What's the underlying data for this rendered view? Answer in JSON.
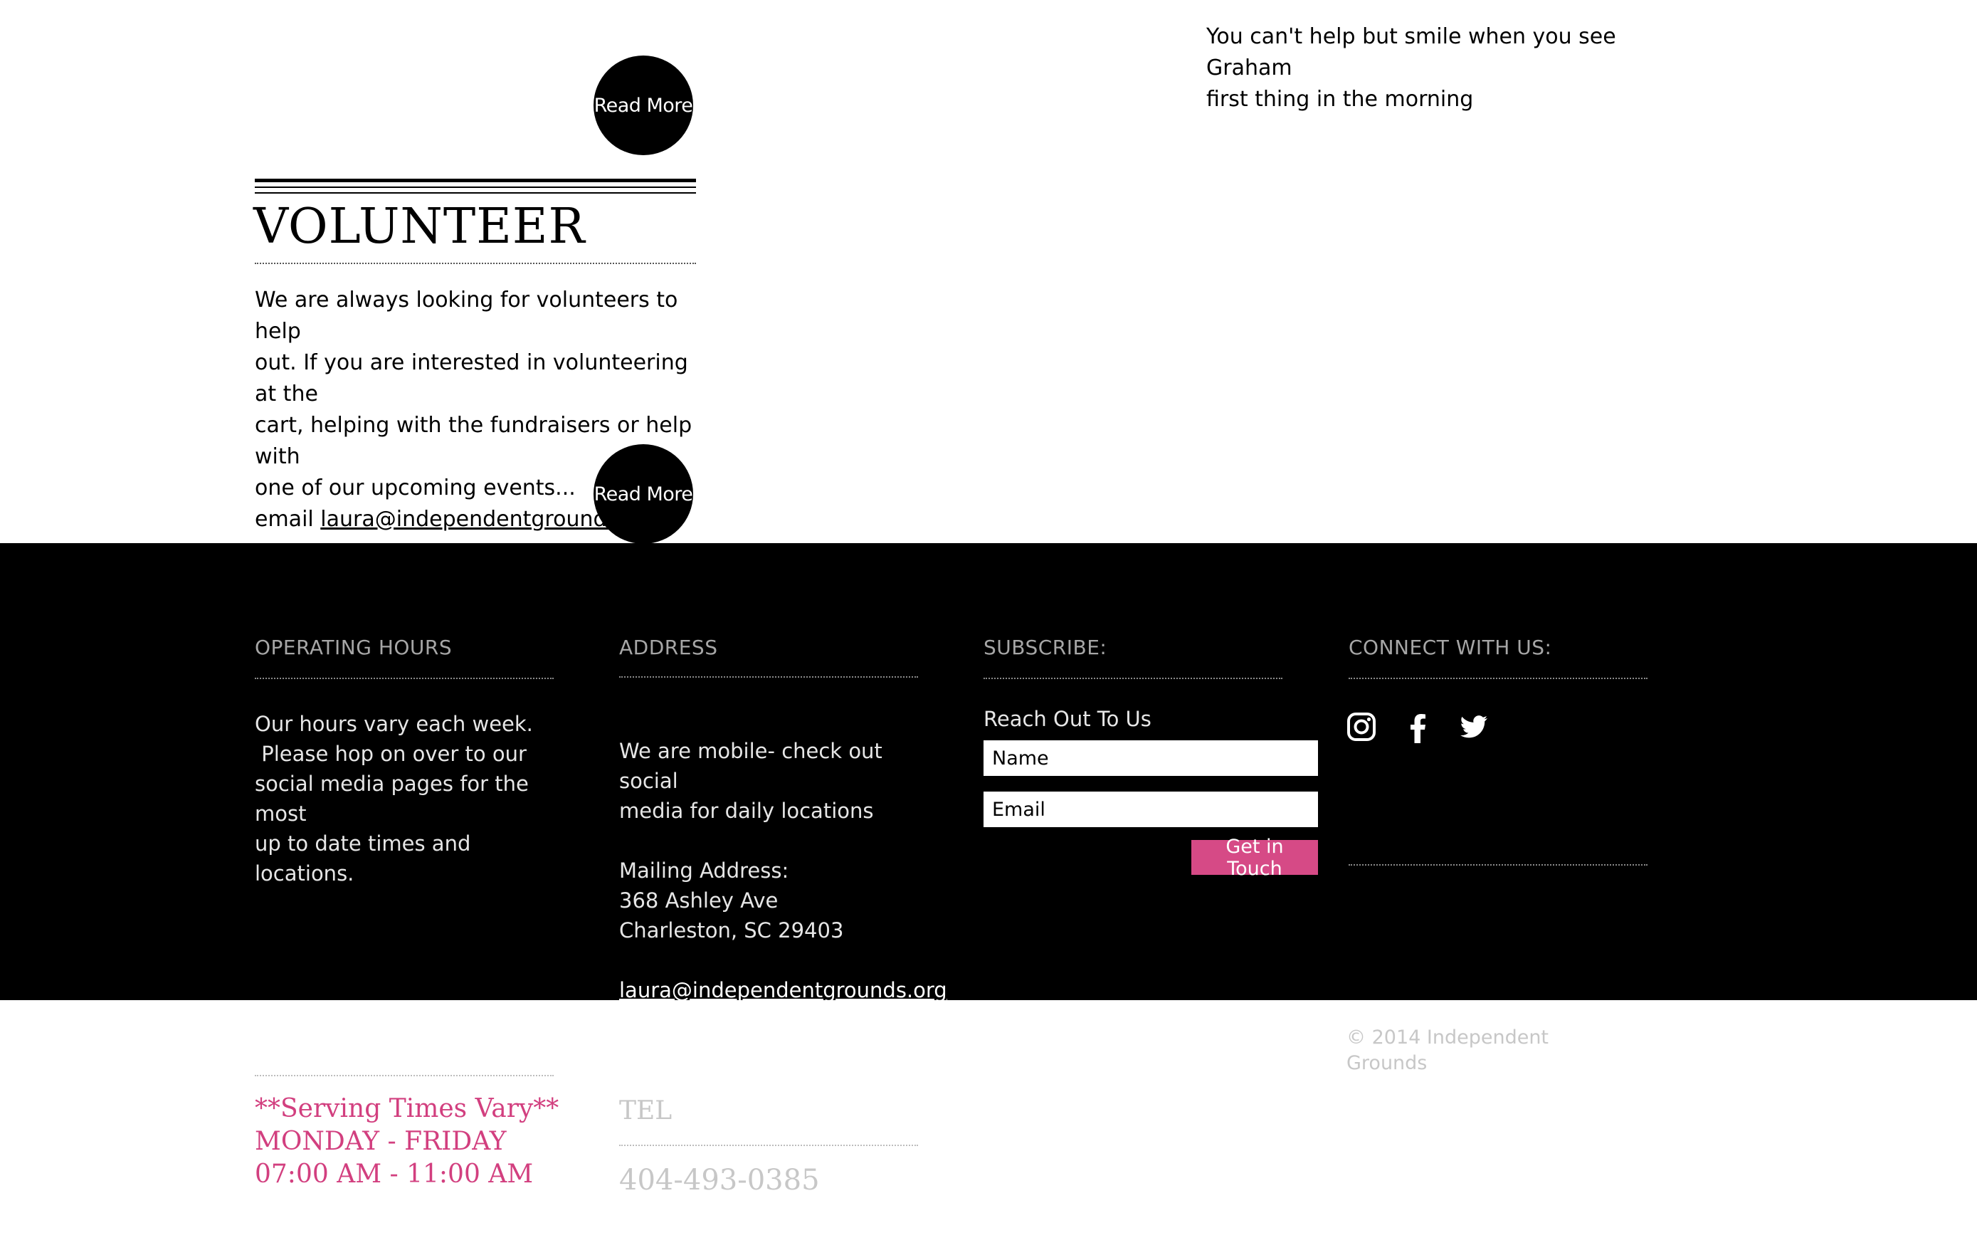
{
  "buttons": {
    "read_more": "Read More"
  },
  "volunteer": {
    "title": "VOLUNTEER",
    "body_lines": [
      "We are always looking for volunteers to help",
      "out.  If you are interested in volunteering at the",
      "cart, helping with the fundraisers or help with",
      "one of our upcoming events..."
    ],
    "email_prefix": "email ",
    "email": "laura@independentgrounds.org"
  },
  "quote": {
    "line1": "You can't help but smile when you see Graham",
    "line2": "first thing in the morning"
  },
  "footer": {
    "hours": {
      "heading": "OPERATING HOURS",
      "lines": [
        "Our hours vary each week.",
        " Please hop on over to our",
        "social media pages for the most",
        "up to date times and locations."
      ]
    },
    "address": {
      "heading": "ADDRESS",
      "mobile_lines": [
        "We are mobile- check out social",
        "media for daily locations"
      ],
      "mailing_label": "Mailing Address:",
      "street": "368 Ashley Ave",
      "city": "Charleston, SC 29403",
      "email": "laura@independentgrounds.org"
    },
    "subscribe": {
      "heading": "SUBSCRIBE:",
      "reach_out": "Reach Out To Us",
      "name_placeholder": "Name",
      "email_placeholder": "Email",
      "submit_label": "Get in Touch"
    },
    "connect": {
      "heading": "CONNECT WITH US:",
      "icons": [
        "instagram-icon",
        "facebook-icon",
        "twitter-icon"
      ]
    }
  },
  "bottom": {
    "copyright_line1": "© 2014 Independent",
    "copyright_line2": "Grounds",
    "serving_lines": [
      "**Serving Times Vary**",
      "MONDAY - FRIDAY",
      "07:00 AM - 11:00 AM"
    ],
    "tel_heading": "TEL",
    "tel_number": "404-493-0385"
  },
  "colors": {
    "accent_pink": "#d64a86",
    "serving_pink": "#d23f7f",
    "footer_bg": "#000000"
  }
}
